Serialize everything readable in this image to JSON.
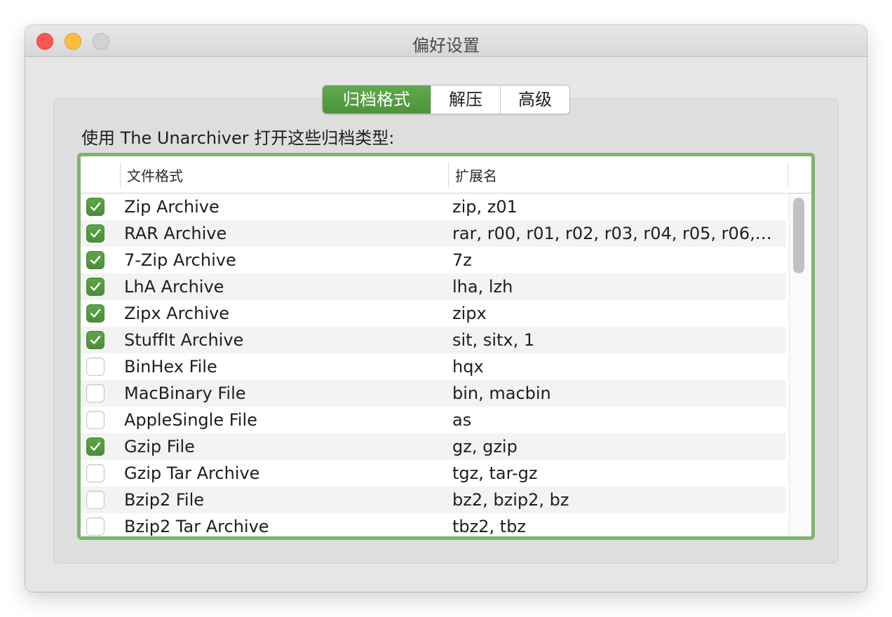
{
  "window": {
    "title": "偏好设置"
  },
  "tabs": [
    {
      "label": "归档格式",
      "active": true
    },
    {
      "label": "解压",
      "active": false
    },
    {
      "label": "高级",
      "active": false
    }
  ],
  "prompt": "使用 The Unarchiver 打开这些归档类型:",
  "table": {
    "columns": [
      "文件格式",
      "扩展名"
    ],
    "rows": [
      {
        "checked": true,
        "name": "Zip Archive",
        "ext": "zip, z01"
      },
      {
        "checked": true,
        "name": "RAR Archive",
        "ext": "rar, r00, r01, r02, r03, r04, r05, r06,…"
      },
      {
        "checked": true,
        "name": "7-Zip Archive",
        "ext": "7z"
      },
      {
        "checked": true,
        "name": "LhA Archive",
        "ext": "lha, lzh"
      },
      {
        "checked": true,
        "name": "Zipx Archive",
        "ext": "zipx"
      },
      {
        "checked": true,
        "name": "StuffIt Archive",
        "ext": "sit, sitx, 1"
      },
      {
        "checked": false,
        "name": "BinHex File",
        "ext": "hqx"
      },
      {
        "checked": false,
        "name": "MacBinary File",
        "ext": "bin, macbin"
      },
      {
        "checked": false,
        "name": "AppleSingle File",
        "ext": "as"
      },
      {
        "checked": true,
        "name": "Gzip File",
        "ext": "gz, gzip"
      },
      {
        "checked": false,
        "name": "Gzip Tar Archive",
        "ext": "tgz, tar-gz"
      },
      {
        "checked": false,
        "name": "Bzip2 File",
        "ext": "bz2, bzip2, bz"
      },
      {
        "checked": false,
        "name": "Bzip2 Tar Archive",
        "ext": "tbz2, tbz"
      }
    ]
  },
  "colors": {
    "accent": "#4d9439",
    "focus_ring": "#7fb26f"
  }
}
